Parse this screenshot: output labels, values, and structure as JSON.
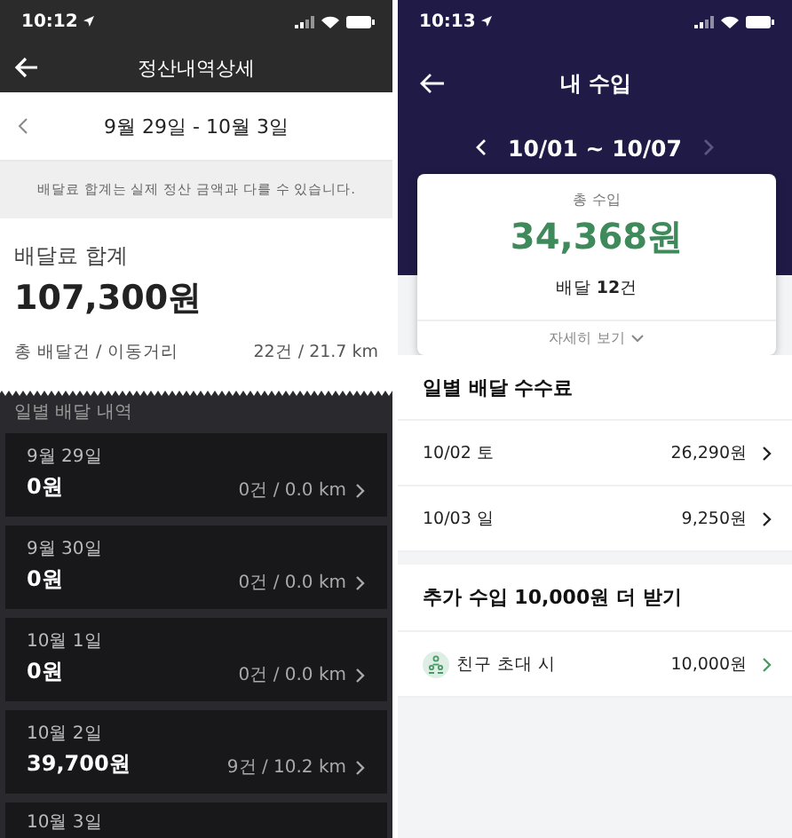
{
  "settlement_screen": {
    "status_bar": {
      "time": "10:12"
    },
    "title": "정산내역상세",
    "period": "9월 29일 - 10월 3일",
    "notice": "배달료 합계는 실제 정산 금액과 다를 수 있습니다.",
    "total_label": "배달료 합계",
    "total": "107,300원",
    "stats_label": "총 배달건 / 이동거리",
    "stats": "22건 / 21.7 km",
    "daily_heading": "일별 배달 내역",
    "days": [
      {
        "date": "9월 29일",
        "amount": "0원",
        "stats": "0건 / 0.0 km"
      },
      {
        "date": "9월 30일",
        "amount": "0원",
        "stats": "0건 / 0.0 km"
      },
      {
        "date": "10월 1일",
        "amount": "0원",
        "stats": "0건 / 0.0 km"
      },
      {
        "date": "10월 2일",
        "amount": "39,700원",
        "stats": "9건 / 10.2 km"
      },
      {
        "date": "10월 3일"
      }
    ]
  },
  "income_screen": {
    "status_bar": {
      "time": "10:13"
    },
    "title": "내 수입",
    "period": "10/01 ~ 10/07",
    "next_disabled": true,
    "total_label": "총 수입",
    "total": "34,368원",
    "deliveries": "배달 **12**건",
    "details_link": "자세히 보기",
    "daily_heading": "일별 배달 수수료",
    "days": [
      {
        "date": "10/02 토",
        "amount": "26,290원"
      },
      {
        "date": "10/03 일",
        "amount": "9,250원"
      }
    ],
    "bonus_heading": "추가 수입 10,000원 더 받기",
    "bonus_rows": [
      {
        "label": "친구 초대 시",
        "amount": "10,000원"
      }
    ]
  }
}
